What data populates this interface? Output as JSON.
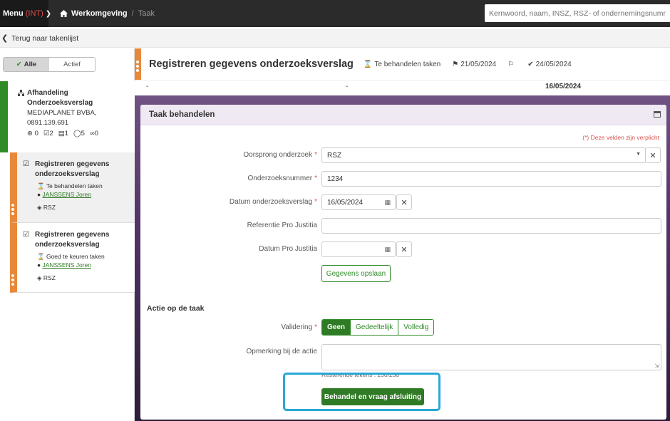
{
  "topbar": {
    "menu_label": "Menu",
    "env_tag": "(INT)",
    "breadcrumb_home": "Werkomgeving",
    "breadcrumb_current": "Taak",
    "search_placeholder": "Kernwoord, naam, INSZ, RSZ- of ondernemingsnummer"
  },
  "back_link": "Terug naar takenlijst",
  "filter": {
    "options": [
      "Alle",
      "Actief"
    ],
    "active": "Alle"
  },
  "case": {
    "title_line1": "Afhandeling",
    "title_line2": "Onderzoeksverslag",
    "company": "MEDIAPLANET BVBA,",
    "number": "0891.139.691",
    "stats": {
      "hierarchy": "0",
      "tasks": "2",
      "documents": "1",
      "comments": "5",
      "links": "0"
    },
    "accent_color": "#2f8a28"
  },
  "tasks": [
    {
      "title_line1": "Registreren gegevens",
      "title_line2": "onderzoeksverslag",
      "status": "Te behandelen taken",
      "assignee": "JANSSENS Joren",
      "tag": "RSZ",
      "selected": true
    },
    {
      "title_line1": "Registreren gegevens",
      "title_line2": "onderzoeksverslag",
      "status": "Goed te keuren taken",
      "assignee": "JANSSENS Joren",
      "tag": "RSZ",
      "selected": false
    }
  ],
  "header": {
    "title": "Registreren gegevens onderzoeksverslag",
    "status": "Te behandelen taken",
    "date_flag": "21/05/2024",
    "date_done": "24/05/2024",
    "row2_col1": "-",
    "row2_col2": "-",
    "row2_col3": "16/05/2024"
  },
  "panel": {
    "title": "Taak behandelen",
    "required_note": "(*) Deze velden zijn verplicht",
    "fields": {
      "oorsprong_label": "Oorsprong onderzoek",
      "oorsprong_value": "RSZ",
      "nummer_label": "Onderzoeksnummer",
      "nummer_value": "1234",
      "datum_label": "Datum onderzoeksverslag",
      "datum_value": "16/05/2024",
      "referentie_label": "Referentie Pro Justitia",
      "referentie_value": "",
      "datum_pj_label": "Datum Pro Justitia",
      "datum_pj_value": ""
    },
    "save_button": "Gegevens opslaan",
    "section_title": "Actie op de taak",
    "validering_label": "Validering",
    "validering_options": [
      "Geen",
      "Gedeeltelijk",
      "Volledig"
    ],
    "validering_selected": "Geen",
    "opmerking_label": "Opmerking bij de actie",
    "remaining_chars": "Resterende tekens : 250/250",
    "submit_button": "Behandel en vraag afsluiting"
  },
  "colors": {
    "primary_green": "#2f7a25",
    "task_orange": "#e8893a",
    "highlight_blue": "#2aa7d6",
    "required_red": "#d9534f"
  }
}
